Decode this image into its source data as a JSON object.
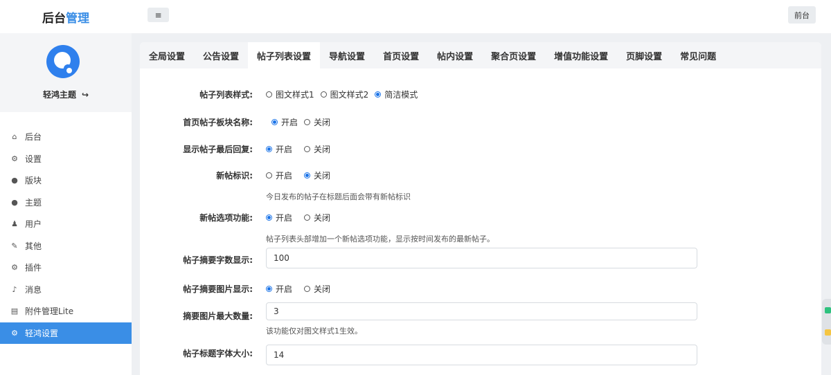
{
  "header": {
    "brand_main": "后台",
    "brand_accent": "管理",
    "menu_icon": "≡",
    "front_label": "前台"
  },
  "sidebar": {
    "user_name": "轻鸿主题",
    "logout_icon": "↪",
    "items": [
      {
        "icon": "⌂",
        "label": "后台"
      },
      {
        "icon": "⚙",
        "label": "设置"
      },
      {
        "icon": "●",
        "label": "版块"
      },
      {
        "icon": "●",
        "label": "主题"
      },
      {
        "icon": "♟",
        "label": "用户"
      },
      {
        "icon": "✎",
        "label": "其他"
      },
      {
        "icon": "⚙",
        "label": "插件"
      },
      {
        "icon": "♪",
        "label": "消息"
      },
      {
        "icon": "▤",
        "label": "附件管理Lite"
      },
      {
        "icon": "⚙",
        "label": "轻鸿设置"
      }
    ],
    "active_index": 9
  },
  "tabs": [
    "全局设置",
    "公告设置",
    "帖子列表设置",
    "导航设置",
    "首页设置",
    "帖内设置",
    "聚合页设置",
    "增值功能设置",
    "页脚设置",
    "常见问题"
  ],
  "active_tab": 2,
  "form": {
    "list_style": {
      "label": "帖子列表样式:",
      "options": [
        "图文样式1",
        "图文样式2",
        "简洁模式"
      ],
      "selected": "简洁模式"
    },
    "home_block_name": {
      "label": "首页帖子板块名称:",
      "options": [
        "开启",
        "关闭"
      ],
      "selected": "开启"
    },
    "show_last_reply": {
      "label": "显示帖子最后回复:",
      "options": [
        "开启",
        "关闭"
      ],
      "selected": "开启"
    },
    "new_post_mark": {
      "label": "新帖标识:",
      "options": [
        "开启",
        "关闭"
      ],
      "selected": "关闭",
      "hint": "今日发布的帖子在标题后面会带有新帖标识"
    },
    "new_post_tab": {
      "label": "新帖选项功能:",
      "options": [
        "开启",
        "关闭"
      ],
      "selected": "开启",
      "hint": "帖子列表头部增加一个新帖选项功能，显示按时间发布的最新帖子。"
    },
    "summary_length": {
      "label": "帖子摘要字数显示:",
      "value": "100"
    },
    "summary_image": {
      "label": "帖子摘要图片显示:",
      "options": [
        "开启",
        "关闭"
      ],
      "selected": "开启"
    },
    "summary_image_max": {
      "label": "摘要图片最大数量:",
      "value": "3",
      "hint": "该功能仅对图文样式1生效。"
    },
    "title_font_size": {
      "label": "帖子标题字体大小:",
      "value": "14"
    }
  }
}
